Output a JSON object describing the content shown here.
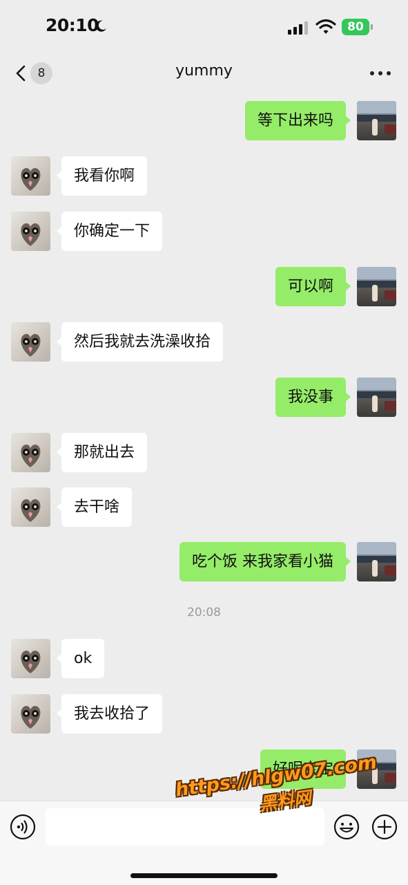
{
  "status_bar": {
    "time": "20:10",
    "battery": "80"
  },
  "nav": {
    "badge": "8",
    "title": "yummy"
  },
  "messages": [
    {
      "text": "等下出来吗"
    },
    {
      "text": "我看你啊"
    },
    {
      "text": "你确定一下"
    },
    {
      "text": "可以啊"
    },
    {
      "text": "然后我就去洗澡收拾"
    },
    {
      "text": "我没事"
    },
    {
      "text": "那就出去"
    },
    {
      "text": "去干啥"
    },
    {
      "text": "吃个饭 来我家看小猫"
    },
    {
      "text": "ok"
    },
    {
      "text": "我去收拾了"
    },
    {
      "text": "好呢宝宝"
    }
  ],
  "timestamp": "20:08",
  "input": {
    "placeholder": ""
  },
  "watermark": {
    "url": "https://hlgw07.com",
    "site": "黑料网"
  },
  "colors": {
    "sent_bubble": "#95ec69",
    "received_bubble": "#ffffff",
    "background": "#ededed",
    "battery": "#34c759",
    "watermark": "#ff9a1f"
  }
}
